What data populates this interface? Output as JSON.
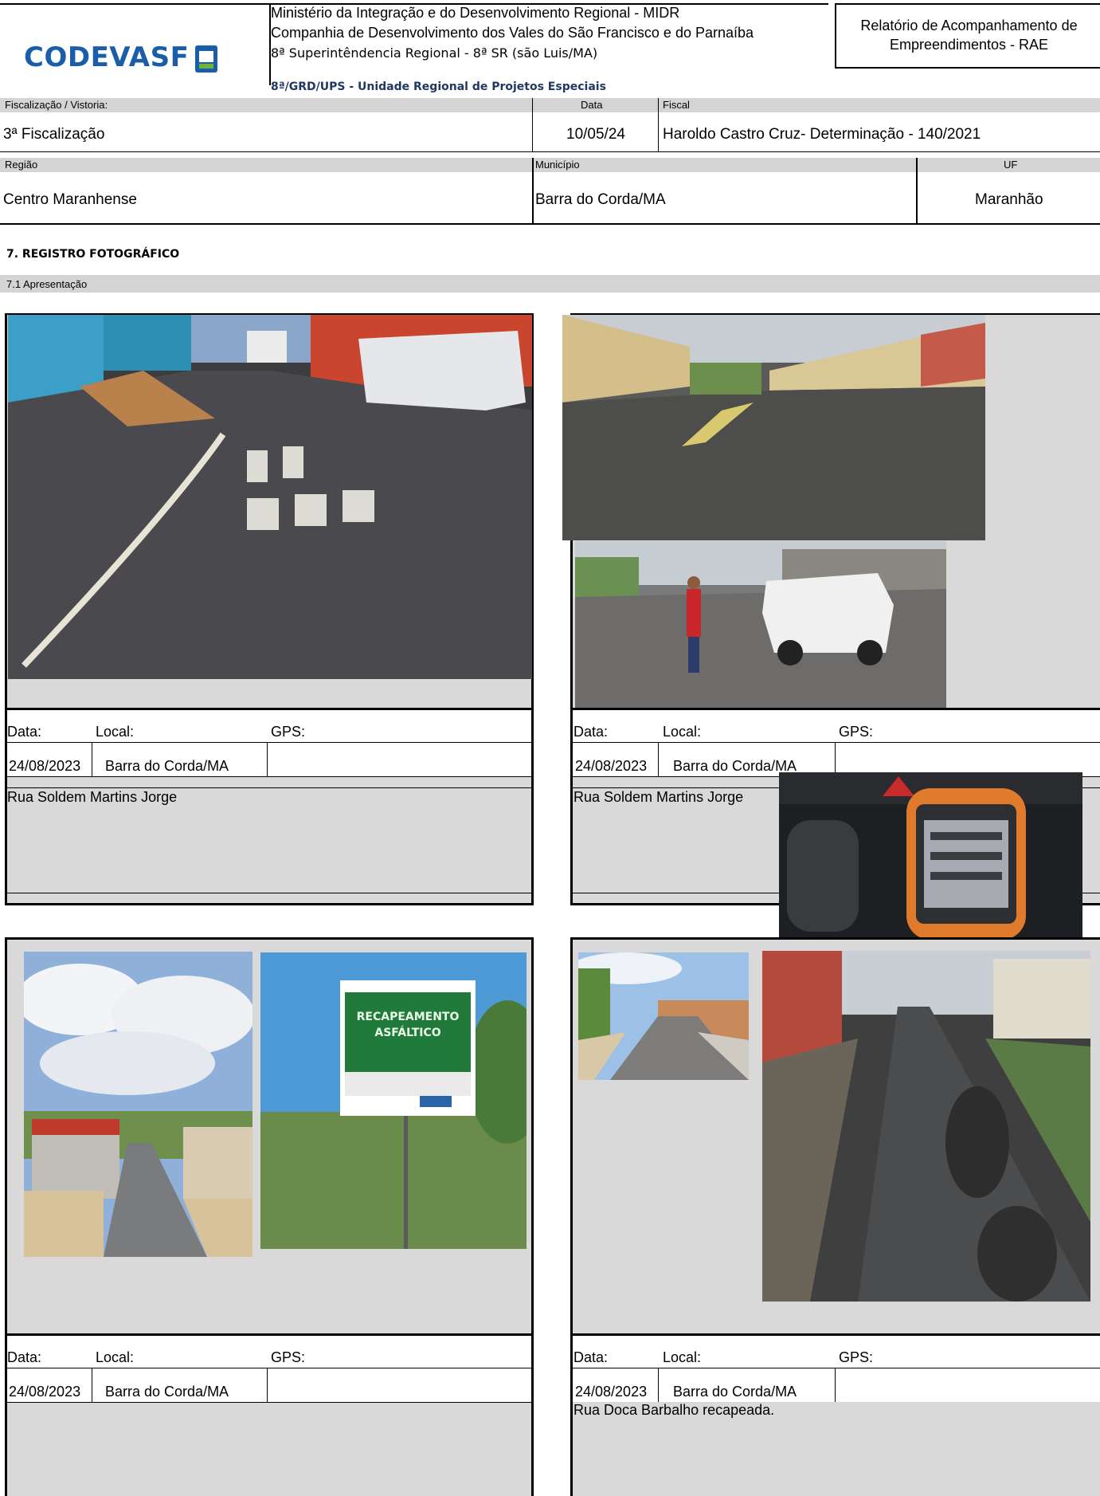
{
  "header": {
    "logo_text": "CODEVASF",
    "org_line1": "Ministério da Integração e do Desenvolvimento Regional - MIDR",
    "org_line2": "Companhia de Desenvolvimento dos Vales do São Francisco e do Parnaíba",
    "org_line3": "8ª Superintêndencia Regional - 8ª SR (são Luis/MA)",
    "unit": "8ª/GRD/UPS - Unidade Regional de Projetos Especiais",
    "report_title_line1": "Relatório de Acompanhamento de",
    "report_title_line2": "Empreendimentos - RAE"
  },
  "info": {
    "fiscalizacao_label": "Fiscalização / Vistoria:",
    "fiscalizacao_value": "3ª Fiscalização",
    "data_label": "Data",
    "data_value": "10/05/24",
    "fiscal_label": "Fiscal",
    "fiscal_value": "Haroldo Castro Cruz- Determinação - 140/2021",
    "regiao_label": "Região",
    "regiao_value": "Centro Maranhense",
    "municipio_label": "Município",
    "municipio_value": "Barra do Corda/MA",
    "uf_label": "UF",
    "uf_value": "Maranhão"
  },
  "section": {
    "title": "7. REGISTRO FOTOGRÁFICO",
    "subtitle": "7.1 Apresentação"
  },
  "photo_cards": [
    {
      "data_label": "Data:",
      "local_label": "Local:",
      "gps_label": "GPS:",
      "date": "24/08/2023",
      "local": "Barra do Corda/MA",
      "gps": "",
      "caption": "Rua Soldem Martins Jorge"
    },
    {
      "data_label": "Data:",
      "local_label": "Local:",
      "gps_label": "GPS:",
      "date": "24/08/2023",
      "local": "Barra do Corda/MA",
      "gps": "",
      "caption": "Rua Soldem Martins Jorge"
    },
    {
      "data_label": "Data:",
      "local_label": "Local:",
      "gps_label": "GPS:",
      "date": "24/08/2023",
      "local": "Barra do Corda/MA",
      "gps": "",
      "caption": ""
    },
    {
      "data_label": "Data:",
      "local_label": "Local:",
      "gps_label": "GPS:",
      "date": "24/08/2023",
      "local": "Barra do Corda/MA",
      "gps": "",
      "caption": "Rua Doca Barbalho recapeada."
    }
  ],
  "sign_text": {
    "line1": "RECAPEAMENTO",
    "line2": "ASFÁLTICO"
  }
}
